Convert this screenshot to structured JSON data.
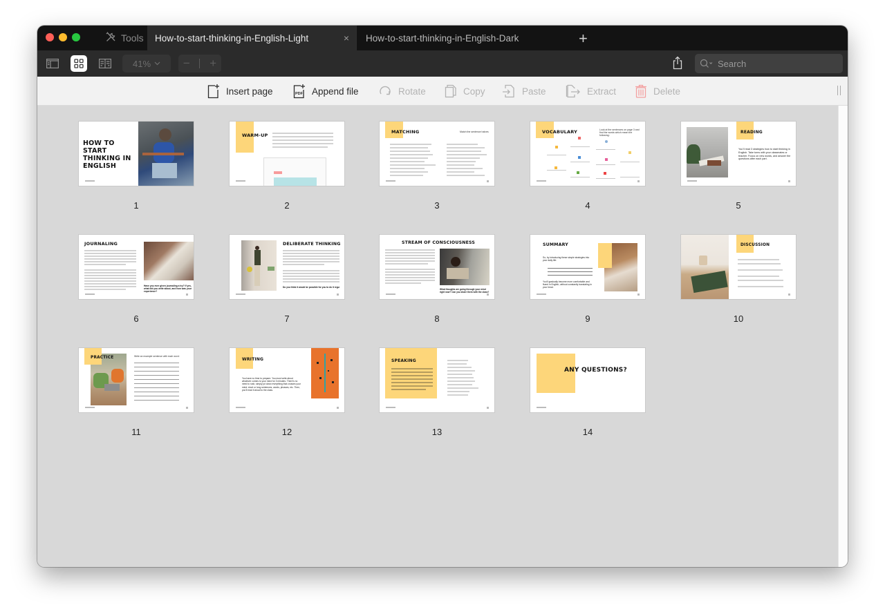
{
  "window": {
    "tools_label": "Tools",
    "tabs": [
      {
        "label": "How-to-start-thinking-in-English-Light",
        "active": true
      },
      {
        "label": "How-to-start-thinking-in-English-Dark",
        "active": false
      }
    ],
    "new_tab_label": "+",
    "close_label": "×"
  },
  "toolbar": {
    "zoom_value": "41%",
    "zoom_out_label": "−",
    "zoom_in_label": "+",
    "search_placeholder": "Search",
    "view_modes": [
      "sidebar-view",
      "grid-view",
      "two-page-view"
    ],
    "active_view": "grid-view"
  },
  "page_toolbar": {
    "buttons": [
      {
        "label": "Insert page",
        "icon": "insert-page-icon",
        "enabled": true
      },
      {
        "label": "Append file",
        "icon": "append-pdf-icon",
        "enabled": true
      },
      {
        "label": "Rotate",
        "icon": "rotate-icon",
        "enabled": false
      },
      {
        "label": "Copy",
        "icon": "copy-icon",
        "enabled": false
      },
      {
        "label": "Paste",
        "icon": "paste-icon",
        "enabled": false
      },
      {
        "label": "Extract",
        "icon": "extract-icon",
        "enabled": false
      },
      {
        "label": "Delete",
        "icon": "trash-icon",
        "enabled": false
      }
    ]
  },
  "colors": {
    "accent_yellow": "#fdd67a",
    "delete_red": "#f3a0a0",
    "orange": "#e8732c"
  },
  "pages": [
    {
      "number": "1",
      "title": "HOW TO START THINKING IN ENGLISH"
    },
    {
      "number": "2",
      "title": "WARM-UP"
    },
    {
      "number": "3",
      "title": "MATCHING",
      "subtitle": "Match the sentence halves"
    },
    {
      "number": "4",
      "title": "VOCABULARY",
      "subtitle": "Look at the sentences on page 3 and find the words which mean the following:"
    },
    {
      "number": "5",
      "title": "READING",
      "body": "You'll read 3 strategies how to start thinking in English. Take turns with your classmates or teacher. Focus on new words, and answer the questions after each part."
    },
    {
      "number": "6",
      "title": "JOURNALING",
      "question": "Have you ever given journaling a try? If yes, what did you write about, and how was your experience?"
    },
    {
      "number": "7",
      "title": "DELIBERATE THINKING",
      "question": "Do you think it would be possible for you to do it regularly?"
    },
    {
      "number": "8",
      "title": "STREAM OF CONSCIOUSNESS",
      "question": "What thoughts are going through your mind right now? Can you share them with the class?"
    },
    {
      "number": "9",
      "title": "SUMMARY",
      "body": "So, by introducing these simple strategies into your daily life:",
      "closing": "You'll gradually become more comfortable and fluent in English, without constantly translating in your head."
    },
    {
      "number": "10",
      "title": "DISCUSSION"
    },
    {
      "number": "11",
      "title": "PRACTICE",
      "subtitle": "Write an example sentence with each word:"
    },
    {
      "number": "12",
      "title": "WRITING",
      "body": "You have no time to prepare. You must write about whatever comes to your mind for 3 minutes. There's no need to rush, simply jot down everything that crosses your mind: short or long sentences, words, phrases, etc. Then, you'll read it aloud to the class."
    },
    {
      "number": "13",
      "title": "SPEAKING"
    },
    {
      "number": "14",
      "title": "ANY QUESTIONS?"
    }
  ]
}
